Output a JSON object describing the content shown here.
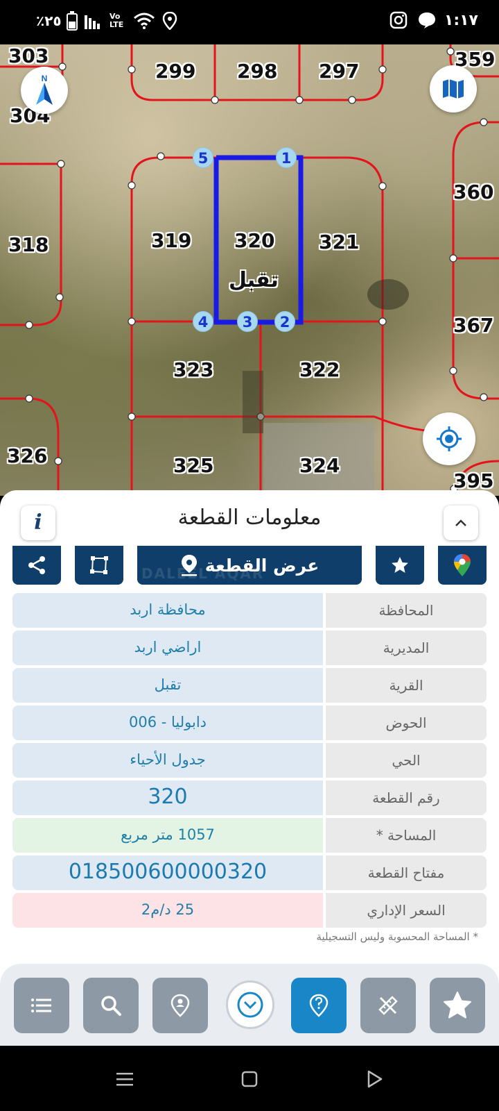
{
  "status_bar": {
    "time": "١:١٧",
    "battery": "٪٢٥",
    "network_label": "Vo LTE"
  },
  "map": {
    "village_label": "تقبل",
    "parcels": [
      {
        "id": "303"
      },
      {
        "id": "299"
      },
      {
        "id": "298"
      },
      {
        "id": "297"
      },
      {
        "id": "359"
      },
      {
        "id": "304"
      },
      {
        "id": "360"
      },
      {
        "id": "318"
      },
      {
        "id": "319"
      },
      {
        "id": "320"
      },
      {
        "id": "321"
      },
      {
        "id": "367"
      },
      {
        "id": "323"
      },
      {
        "id": "322"
      },
      {
        "id": "326"
      },
      {
        "id": "325"
      },
      {
        "id": "324"
      },
      {
        "id": "395"
      }
    ],
    "vertices": [
      "1",
      "2",
      "3",
      "4",
      "5"
    ],
    "compass_letter": "N"
  },
  "panel": {
    "title": "معلومات القطعة",
    "info_glyph": "i",
    "show_parcel_label": "عرض القطعة",
    "watermark": "DALEEL AQAR",
    "rows": [
      {
        "label": "المحافظة",
        "value": "محافظة اربد"
      },
      {
        "label": "المديرية",
        "value": "اراضي اربد"
      },
      {
        "label": "القرية",
        "value": "تقبل"
      },
      {
        "label": "الحوض",
        "value": "دابوليا - 006"
      },
      {
        "label": "الحي",
        "value": "جدول الأحياء"
      },
      {
        "label": "رقم القطعة",
        "value": "320"
      },
      {
        "label": "المساحة *",
        "value": "1057  متر مربع"
      },
      {
        "label": "مفتاح القطعة",
        "value": "018500600000320"
      },
      {
        "label": "السعر الإداري",
        "value": "25 د/م2"
      }
    ],
    "footnote": "* المساحة المحسوبة وليس التسجيلية"
  },
  "colors": {
    "primary": "#0f3e6a",
    "accent": "#1886c7",
    "parcel_line": "#e3141b",
    "selected_parcel": "#1a1ae6"
  }
}
